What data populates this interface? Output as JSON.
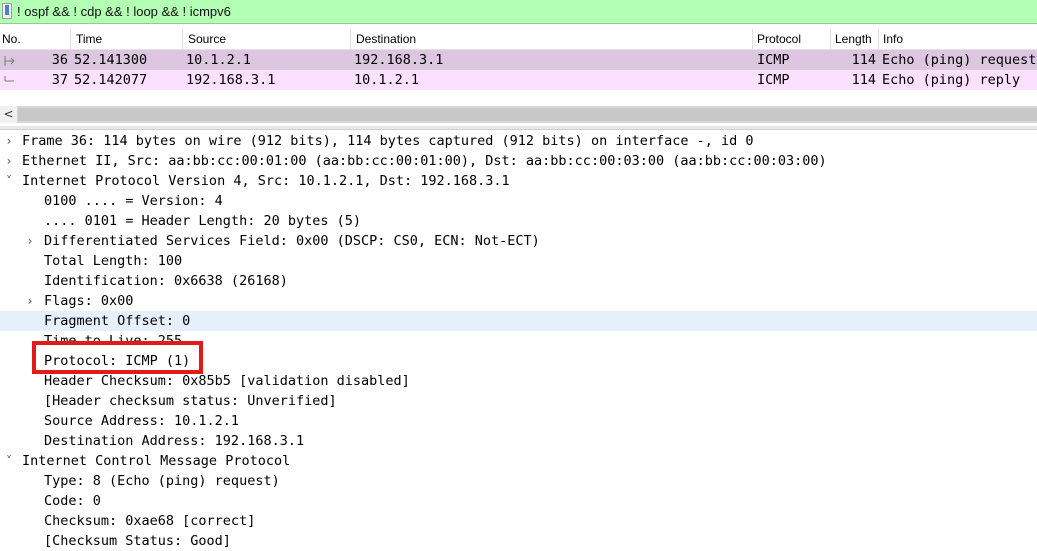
{
  "filter": {
    "text": "! ospf && ! cdp && ! loop && ! icmpv6"
  },
  "columns": [
    "No.",
    "Time",
    "Source",
    "Destination",
    "Protocol",
    "Length",
    "Info"
  ],
  "packets": [
    {
      "no": "36",
      "time": "52.141300",
      "source": "10.1.2.1",
      "destination": "192.168.3.1",
      "protocol": "ICMP",
      "length": "114",
      "info": "Echo (ping) request"
    },
    {
      "no": "37",
      "time": "52.142077",
      "source": "192.168.3.1",
      "destination": "10.1.2.1",
      "protocol": "ICMP",
      "length": "114",
      "info": "Echo (ping) reply"
    }
  ],
  "scroll": {
    "left_arrow": "<"
  },
  "tree": [
    {
      "toggle": ">",
      "text": "Frame 36: 114 bytes on wire (912 bits), 114 bytes captured (912 bits) on interface -, id 0"
    },
    {
      "toggle": ">",
      "text": "Ethernet II, Src: aa:bb:cc:00:01:00 (aa:bb:cc:00:01:00), Dst: aa:bb:cc:00:03:00 (aa:bb:cc:00:03:00)"
    },
    {
      "toggle": "v",
      "text": "Internet Protocol Version 4, Src: 10.1.2.1, Dst: 192.168.3.1"
    },
    {
      "toggle": "",
      "text": "0100 .... = Version: 4"
    },
    {
      "toggle": "",
      "text": ".... 0101 = Header Length: 20 bytes (5)"
    },
    {
      "toggle": ">",
      "text": "Differentiated Services Field: 0x00 (DSCP: CS0, ECN: Not-ECT)"
    },
    {
      "toggle": "",
      "text": "Total Length: 100"
    },
    {
      "toggle": "",
      "text": "Identification: 0x6638 (26168)"
    },
    {
      "toggle": ">",
      "text": "Flags: 0x00"
    },
    {
      "toggle": "",
      "text": "Fragment Offset: 0"
    },
    {
      "toggle": "",
      "text": "Time to Live: 255"
    },
    {
      "toggle": "",
      "text": "Protocol: ICMP (1)"
    },
    {
      "toggle": "",
      "text": "Header Checksum: 0x85b5 [validation disabled]"
    },
    {
      "toggle": "",
      "text": "[Header checksum status: Unverified]"
    },
    {
      "toggle": "",
      "text": "Source Address: 10.1.2.1"
    },
    {
      "toggle": "",
      "text": "Destination Address: 192.168.3.1"
    },
    {
      "toggle": "v",
      "text": "Internet Control Message Protocol"
    },
    {
      "toggle": "",
      "text": "Type: 8 (Echo (ping) request)"
    },
    {
      "toggle": "",
      "text": "Code: 0"
    },
    {
      "toggle": "",
      "text": "Checksum: 0xae68 [correct]"
    },
    {
      "toggle": "",
      "text": "[Checksum Status: Good]"
    }
  ],
  "colors": {
    "selected_row": "#dcc6e0",
    "icmp_row": "#fce0ff",
    "filter_bg": "#b3ffb3",
    "annotation": "#e31a1a"
  }
}
